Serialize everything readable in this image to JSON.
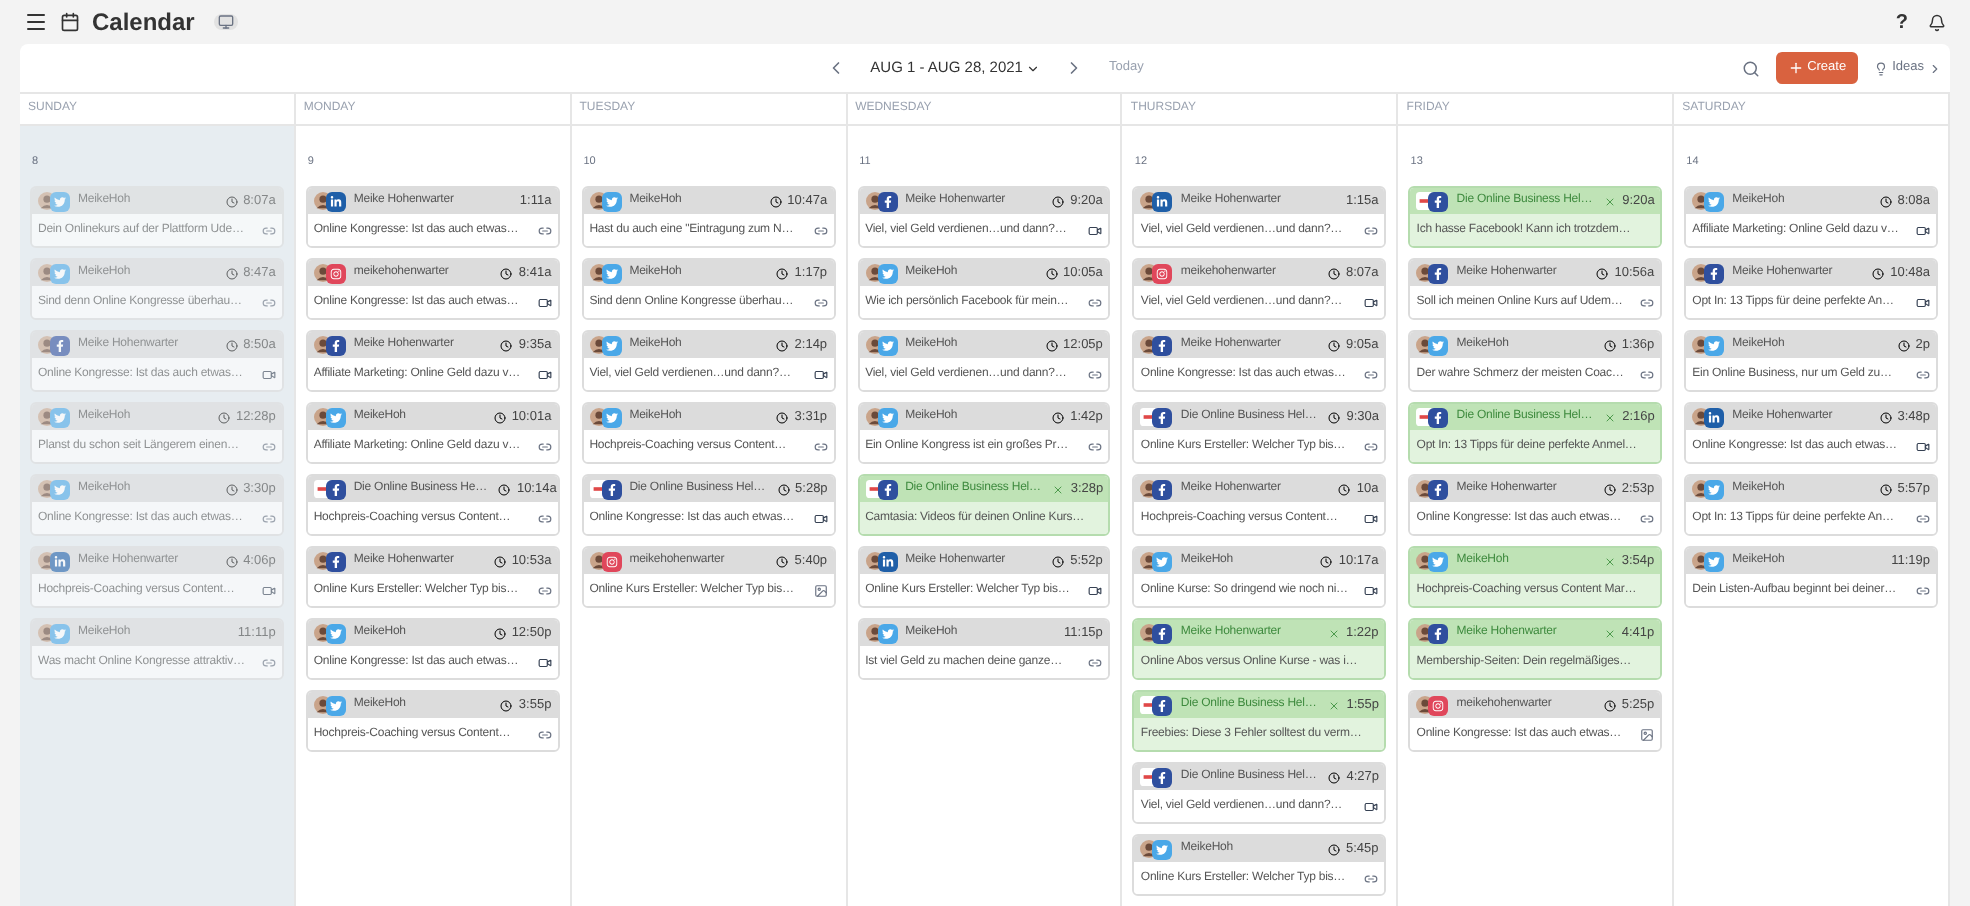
{
  "app": {
    "title": "Calendar",
    "help": "?"
  },
  "toolbar": {
    "range": "AUG 1 - AUG 28, 2021",
    "today": "Today",
    "create": "Create",
    "ideas": "Ideas"
  },
  "days": [
    {
      "name": "SUNDAY",
      "date": "8",
      "past": true,
      "posts": [
        {
          "kind": "twitter",
          "account": "MeikeHoh",
          "logo": false,
          "time": "8:07a",
          "clock": true,
          "text": "Dein Onlinekurs auf der Plattform Ude…",
          "attachment": {
            "kind": "link"
          },
          "published": false
        },
        {
          "kind": "twitter",
          "account": "MeikeHoh",
          "logo": false,
          "time": "8:47a",
          "clock": true,
          "text": "Sind denn Online Kongresse überhau…",
          "attachment": {
            "kind": "link"
          },
          "published": false
        },
        {
          "kind": "facebook",
          "account": "Meike Hohenwarter",
          "logo": false,
          "time": "8:50a",
          "clock": true,
          "text": "Online Kongresse: Ist das auch etwas…",
          "attachment": {
            "kind": "video"
          },
          "published": false
        },
        {
          "kind": "twitter",
          "account": "MeikeHoh",
          "logo": false,
          "time": "12:28p",
          "clock": true,
          "text": "Planst du schon seit Längerem einen…",
          "attachment": {
            "kind": "link"
          },
          "published": false
        },
        {
          "kind": "twitter",
          "account": "MeikeHoh",
          "logo": false,
          "time": "3:30p",
          "clock": true,
          "text": "Online Kongresse: Ist das auch etwas…",
          "attachment": {
            "kind": "link"
          },
          "published": false
        },
        {
          "kind": "linkedin",
          "account": "Meike Hohenwarter",
          "logo": false,
          "time": "4:06p",
          "clock": true,
          "text": "Hochpreis-Coaching versus Content…",
          "attachment": {
            "kind": "video"
          },
          "published": false
        },
        {
          "kind": "twitter",
          "account": "MeikeHoh",
          "logo": false,
          "time": "11:11p",
          "clock": false,
          "text": "Was macht Online Kongresse attraktiv…",
          "attachment": {
            "kind": "link"
          },
          "published": false
        }
      ]
    },
    {
      "name": "MONDAY",
      "date": "9",
      "past": false,
      "posts": [
        {
          "kind": "linkedin",
          "account": "Meike Hohenwarter",
          "logo": false,
          "time": "1:11a",
          "clock": false,
          "text": "Online Kongresse: Ist das auch etwas…",
          "attachment": {
            "kind": "link"
          },
          "published": false
        },
        {
          "kind": "instagram",
          "account": "meikehohenwarter",
          "logo": false,
          "time": "8:41a",
          "clock": true,
          "text": "Online Kongresse: Ist das auch etwas…",
          "attachment": {
            "kind": "video"
          },
          "published": false
        },
        {
          "kind": "facebook",
          "account": "Meike Hohenwarter",
          "logo": false,
          "time": "9:35a",
          "clock": true,
          "text": "Affiliate Marketing: Online Geld dazu v…",
          "attachment": {
            "kind": "video"
          },
          "published": false
        },
        {
          "kind": "twitter",
          "account": "MeikeHoh",
          "logo": false,
          "time": "10:01a",
          "clock": true,
          "text": "Affiliate Marketing: Online Geld dazu v…",
          "attachment": {
            "kind": "link"
          },
          "published": false
        },
        {
          "kind": "facebook",
          "account": "Die Online Business He…",
          "logo": true,
          "time": "10:14a",
          "clock": true,
          "text": "Hochpreis-Coaching versus Content…",
          "attachment": {
            "kind": "link"
          },
          "published": false
        },
        {
          "kind": "facebook",
          "account": "Meike Hohenwarter",
          "logo": false,
          "time": "10:53a",
          "clock": true,
          "text": "Online Kurs Ersteller: Welcher Typ bis…",
          "attachment": {
            "kind": "link"
          },
          "published": false
        },
        {
          "kind": "twitter",
          "account": "MeikeHoh",
          "logo": false,
          "time": "12:50p",
          "clock": true,
          "text": "Online Kongresse: Ist das auch etwas…",
          "attachment": {
            "kind": "video"
          },
          "published": false
        },
        {
          "kind": "twitter",
          "account": "MeikeHoh",
          "logo": false,
          "time": "3:55p",
          "clock": true,
          "text": "Hochpreis-Coaching versus Content…",
          "attachment": {
            "kind": "link"
          },
          "published": false
        }
      ]
    },
    {
      "name": "TUESDAY",
      "date": "10",
      "past": false,
      "posts": [
        {
          "kind": "twitter",
          "account": "MeikeHoh",
          "logo": false,
          "time": "10:47a",
          "clock": true,
          "text": "Hast du auch eine \"Eintragung zum N…",
          "attachment": {
            "kind": "link"
          },
          "published": false
        },
        {
          "kind": "twitter",
          "account": "MeikeHoh",
          "logo": false,
          "time": "1:17p",
          "clock": true,
          "text": "Sind denn Online Kongresse überhau…",
          "attachment": {
            "kind": "link"
          },
          "published": false
        },
        {
          "kind": "twitter",
          "account": "MeikeHoh",
          "logo": false,
          "time": "2:14p",
          "clock": true,
          "text": "Viel, viel Geld verdienen…und dann?…",
          "attachment": {
            "kind": "video"
          },
          "published": false
        },
        {
          "kind": "twitter",
          "account": "MeikeHoh",
          "logo": false,
          "time": "3:31p",
          "clock": true,
          "text": "Hochpreis-Coaching versus Content…",
          "attachment": {
            "kind": "link"
          },
          "published": false
        },
        {
          "kind": "facebook",
          "account": "Die Online Business Hel…",
          "logo": true,
          "time": "5:28p",
          "clock": true,
          "text": "Online Kongresse: Ist das auch etwas…",
          "attachment": {
            "kind": "video"
          },
          "published": false
        },
        {
          "kind": "instagram",
          "account": "meikehohenwarter",
          "logo": false,
          "time": "5:40p",
          "clock": true,
          "text": "Online Kurs Ersteller: Welcher Typ bis…",
          "attachment": {
            "kind": "image"
          },
          "published": false
        }
      ]
    },
    {
      "name": "WEDNESDAY",
      "date": "11",
      "past": false,
      "posts": [
        {
          "kind": "facebook",
          "account": "Meike Hohenwarter",
          "logo": false,
          "time": "9:20a",
          "clock": true,
          "text": "Viel, viel Geld verdienen…und dann?…",
          "attachment": {
            "kind": "video"
          },
          "published": false
        },
        {
          "kind": "twitter",
          "account": "MeikeHoh",
          "logo": false,
          "time": "10:05a",
          "clock": true,
          "text": "Wie ich persönlich Facebook für mein…",
          "attachment": {
            "kind": "link"
          },
          "published": false
        },
        {
          "kind": "twitter",
          "account": "MeikeHoh",
          "logo": false,
          "time": "12:05p",
          "clock": true,
          "text": "Viel, viel Geld verdienen…und dann?…",
          "attachment": {
            "kind": "link"
          },
          "published": false
        },
        {
          "kind": "twitter",
          "account": "MeikeHoh",
          "logo": false,
          "time": "1:42p",
          "clock": true,
          "text": "Ein Online Kongress ist ein großes Pr…",
          "attachment": {
            "kind": "link"
          },
          "published": false
        },
        {
          "kind": "facebook",
          "account": "Die Online Business Hel…",
          "logo": true,
          "time": "3:28p",
          "text": "Camtasia: Videos für deinen Online Kurs…",
          "published": true
        },
        {
          "kind": "linkedin",
          "account": "Meike Hohenwarter",
          "logo": false,
          "time": "5:52p",
          "clock": true,
          "text": "Online Kurs Ersteller: Welcher Typ bis…",
          "attachment": {
            "kind": "video"
          },
          "published": false
        },
        {
          "kind": "twitter",
          "account": "MeikeHoh",
          "logo": false,
          "time": "11:15p",
          "clock": false,
          "text": "Ist viel Geld zu machen deine ganze…",
          "attachment": {
            "kind": "link"
          },
          "published": false
        }
      ]
    },
    {
      "name": "THURSDAY",
      "date": "12",
      "past": false,
      "posts": [
        {
          "kind": "linkedin",
          "account": "Meike Hohenwarter",
          "logo": false,
          "time": "1:15a",
          "clock": false,
          "text": "Viel, viel Geld verdienen…und dann?…",
          "attachment": {
            "kind": "link"
          },
          "published": false
        },
        {
          "kind": "instagram",
          "account": "meikehohenwarter",
          "logo": false,
          "time": "8:07a",
          "clock": true,
          "text": "Viel, viel Geld verdienen…und dann?…",
          "attachment": {
            "kind": "video"
          },
          "published": false
        },
        {
          "kind": "facebook",
          "account": "Meike Hohenwarter",
          "logo": false,
          "time": "9:05a",
          "clock": true,
          "text": "Online Kongresse: Ist das auch etwas…",
          "attachment": {
            "kind": "link"
          },
          "published": false
        },
        {
          "kind": "facebook",
          "account": "Die Online Business Hel…",
          "logo": true,
          "time": "9:30a",
          "clock": true,
          "text": "Online Kurs Ersteller: Welcher Typ bis…",
          "attachment": {
            "kind": "link"
          },
          "published": false
        },
        {
          "kind": "facebook",
          "account": "Meike Hohenwarter",
          "logo": false,
          "time": "10a",
          "clock": true,
          "text": "Hochpreis-Coaching versus Content…",
          "attachment": {
            "kind": "video"
          },
          "published": false
        },
        {
          "kind": "twitter",
          "account": "MeikeHoh",
          "logo": false,
          "time": "10:17a",
          "clock": true,
          "text": "Online Kurse: So dringend wie noch ni…",
          "attachment": {
            "kind": "video"
          },
          "published": false
        },
        {
          "kind": "facebook",
          "account": "Meike Hohenwarter",
          "logo": false,
          "time": "1:22p",
          "text": "Online Abos versus Online Kurse - was i…",
          "published": true
        },
        {
          "kind": "facebook",
          "account": "Die Online Business Hel…",
          "logo": true,
          "time": "1:55p",
          "text": "Freebies: Diese 3 Fehler solltest du verm…",
          "published": true
        },
        {
          "kind": "facebook",
          "account": "Die Online Business Hel…",
          "logo": true,
          "time": "4:27p",
          "clock": true,
          "text": "Viel, viel Geld verdienen…und dann?…",
          "attachment": {
            "kind": "video"
          },
          "published": false
        },
        {
          "kind": "twitter",
          "account": "MeikeHoh",
          "logo": false,
          "time": "5:45p",
          "clock": true,
          "text": "Online Kurs Ersteller: Welcher Typ bis…",
          "attachment": {
            "kind": "link"
          },
          "published": false
        }
      ]
    },
    {
      "name": "FRIDAY",
      "date": "13",
      "past": false,
      "posts": [
        {
          "kind": "facebook",
          "account": "Die Online Business Hel…",
          "logo": true,
          "time": "9:20a",
          "text": "Ich hasse Facebook! Kann ich trotzdem…",
          "published": true
        },
        {
          "kind": "facebook",
          "account": "Meike Hohenwarter",
          "logo": false,
          "time": "10:56a",
          "clock": true,
          "text": "Soll ich meinen Online Kurs auf Udem…",
          "attachment": {
            "kind": "link"
          },
          "published": false
        },
        {
          "kind": "twitter",
          "account": "MeikeHoh",
          "logo": false,
          "time": "1:36p",
          "clock": true,
          "text": "Der wahre Schmerz der meisten Coac…",
          "attachment": {
            "kind": "link"
          },
          "published": false
        },
        {
          "kind": "facebook",
          "account": "Die Online Business Hel…",
          "logo": true,
          "time": "2:16p",
          "text": "Opt In: 13 Tipps für deine perfekte Anmel…",
          "published": true
        },
        {
          "kind": "facebook",
          "account": "Meike Hohenwarter",
          "logo": false,
          "time": "2:53p",
          "clock": true,
          "text": "Online Kongresse: Ist das auch etwas…",
          "attachment": {
            "kind": "link"
          },
          "published": false
        },
        {
          "kind": "twitter",
          "account": "MeikeHoh",
          "logo": false,
          "time": "3:54p",
          "text": "Hochpreis-Coaching versus Content Mar…",
          "published": true
        },
        {
          "kind": "facebook",
          "account": "Meike Hohenwarter",
          "logo": false,
          "time": "4:41p",
          "text": "Membership-Seiten: Dein regelmäßiges…",
          "published": true
        },
        {
          "kind": "instagram",
          "account": "meikehohenwarter",
          "logo": false,
          "time": "5:25p",
          "clock": true,
          "text": "Online Kongresse: Ist das auch etwas…",
          "attachment": {
            "kind": "image"
          },
          "published": false
        }
      ]
    },
    {
      "name": "SATURDAY",
      "date": "14",
      "past": false,
      "posts": [
        {
          "kind": "twitter",
          "account": "MeikeHoh",
          "logo": false,
          "time": "8:08a",
          "clock": true,
          "text": "Affiliate Marketing: Online Geld dazu v…",
          "attachment": {
            "kind": "video"
          },
          "published": false
        },
        {
          "kind": "facebook",
          "account": "Meike Hohenwarter",
          "logo": false,
          "time": "10:48a",
          "clock": true,
          "text": "Opt In: 13 Tipps für deine perfekte An…",
          "attachment": {
            "kind": "video"
          },
          "published": false
        },
        {
          "kind": "twitter",
          "account": "MeikeHoh",
          "logo": false,
          "time": "2p",
          "clock": true,
          "text": "Ein Online Business, nur um Geld zu…",
          "attachment": {
            "kind": "link"
          },
          "published": false
        },
        {
          "kind": "linkedin",
          "account": "Meike Hohenwarter",
          "logo": false,
          "time": "3:48p",
          "clock": true,
          "text": "Online Kongresse: Ist das auch etwas…",
          "attachment": {
            "kind": "video"
          },
          "published": false
        },
        {
          "kind": "twitter",
          "account": "MeikeHoh",
          "logo": false,
          "time": "5:57p",
          "clock": true,
          "text": "Opt In: 13 Tipps für deine perfekte An…",
          "attachment": {
            "kind": "link"
          },
          "published": false
        },
        {
          "kind": "twitter",
          "account": "MeikeHoh",
          "logo": false,
          "time": "11:19p",
          "clock": false,
          "text": "Dein Listen-Aufbau beginnt bei deiner…",
          "attachment": {
            "kind": "link"
          },
          "published": false
        }
      ]
    }
  ]
}
